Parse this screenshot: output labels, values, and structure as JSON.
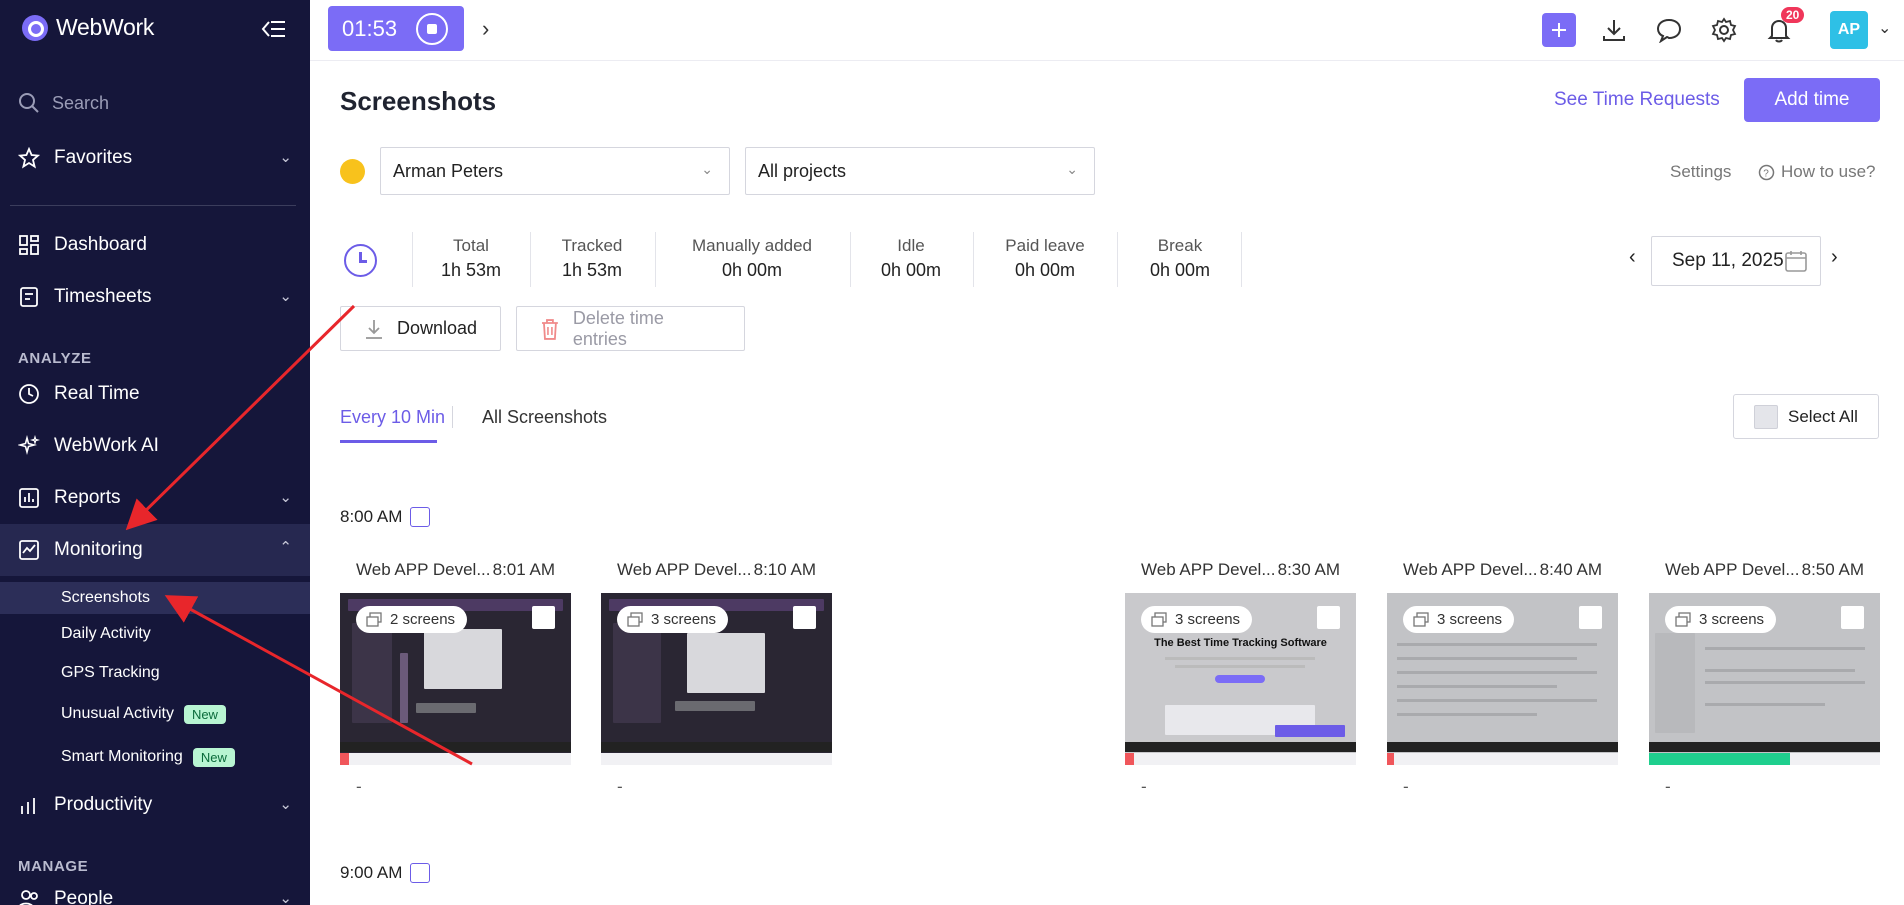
{
  "app": {
    "name": "WebWork"
  },
  "sidebar": {
    "search_placeholder": "Search",
    "favorites": "Favorites",
    "dashboard": "Dashboard",
    "timesheets": "Timesheets",
    "section_analyze": "ANALYZE",
    "real_time": "Real Time",
    "webwork_ai": "WebWork AI",
    "reports": "Reports",
    "monitoring": "Monitoring",
    "monitoring_sub": [
      {
        "label": "Screenshots",
        "active": true
      },
      {
        "label": "Daily Activity"
      },
      {
        "label": "GPS Tracking"
      },
      {
        "label": "Unusual Activity",
        "badge": "New"
      },
      {
        "label": "Smart Monitoring",
        "badge": "New"
      }
    ],
    "productivity": "Productivity",
    "section_manage": "MANAGE",
    "people": "People"
  },
  "topbar": {
    "timer": "01:53",
    "notification_count": "20",
    "avatar_initials": "AP"
  },
  "page": {
    "title": "Screenshots",
    "see_time_requests": "See Time Requests",
    "add_time": "Add time",
    "user_select": "Arman Peters",
    "project_select": "All projects",
    "settings": "Settings",
    "how_to_use": "How to use?",
    "stats": [
      {
        "label": "Total",
        "value": "1h 53m"
      },
      {
        "label": "Tracked",
        "value": "1h 53m"
      },
      {
        "label": "Manually added",
        "value": "0h 00m"
      },
      {
        "label": "Idle",
        "value": "0h 00m"
      },
      {
        "label": "Paid leave",
        "value": "0h 00m"
      },
      {
        "label": "Break",
        "value": "0h 00m"
      }
    ],
    "date": "Sep 11, 2025",
    "download": "Download",
    "delete_entries": "Delete time entries",
    "tabs": [
      "Every 10 Min",
      "All Screenshots"
    ],
    "select_all": "Select All",
    "hours": [
      {
        "label": "8:00 AM",
        "screenshots": [
          {
            "project": "Web APP Devel...",
            "time": "8:01 AM",
            "count": "2 screens",
            "note": "-",
            "activity": 0.04,
            "activity_color": "#f0565b",
            "theme": "dark"
          },
          {
            "project": "Web APP Devel...",
            "time": "8:10 AM",
            "count": "3 screens",
            "note": "-",
            "activity": 0,
            "activity_color": "#f0565b",
            "theme": "dark"
          },
          {
            "project": "Web APP Devel...",
            "time": "8:30 AM",
            "count": "3 screens",
            "note": "-",
            "activity": 0.04,
            "activity_color": "#f0565b",
            "theme": "light"
          },
          {
            "project": "Web APP Devel...",
            "time": "8:40 AM",
            "count": "3 screens",
            "note": "-",
            "activity": 0.03,
            "activity_color": "#f0565b",
            "theme": "mid"
          },
          {
            "project": "Web APP Devel...",
            "time": "8:50 AM",
            "count": "3 screens",
            "note": "-",
            "activity": 0.61,
            "activity_color": "#1fcf8e",
            "theme": "mid"
          }
        ]
      },
      {
        "label": "9:00 AM",
        "screenshots": []
      }
    ],
    "shot_headline": "The Best Time Tracking Software"
  },
  "colors": {
    "accent": "#7b6cf6",
    "sidebar_bg": "#15163a",
    "annotation_arrow": "#e8262b"
  }
}
